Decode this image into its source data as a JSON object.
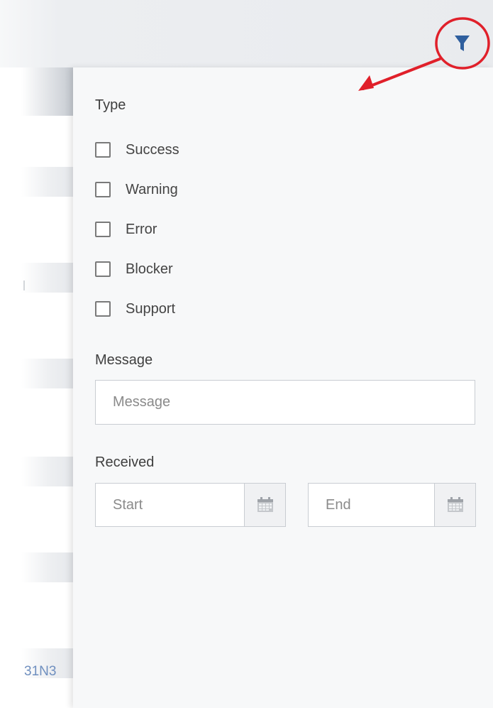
{
  "left_strip": {
    "device_id_fragment": "31N3"
  },
  "filter_panel": {
    "type_label": "Type",
    "type_options": [
      {
        "label": "Success",
        "checked": false
      },
      {
        "label": "Warning",
        "checked": false
      },
      {
        "label": "Error",
        "checked": false
      },
      {
        "label": "Blocker",
        "checked": false
      },
      {
        "label": "Support",
        "checked": false
      }
    ],
    "message_label": "Message",
    "message_placeholder": "Message",
    "received_label": "Received",
    "start_placeholder": "Start",
    "end_placeholder": "End"
  },
  "icons": {
    "filter": "filter-icon",
    "calendar": "calendar-icon"
  },
  "colors": {
    "annotation_red": "#e0202a",
    "filter_icon": "#2f5f9e",
    "panel_background": "#f7f8f9",
    "header_background": "#e9ebee"
  }
}
